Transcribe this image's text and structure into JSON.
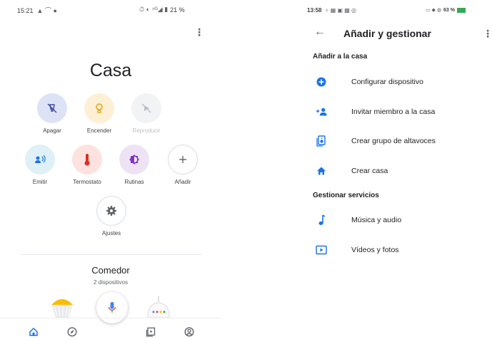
{
  "left": {
    "status": {
      "time": "15:21",
      "right_text": "21 %"
    },
    "title": "Casa",
    "quick_actions": [
      {
        "label": "Apagar",
        "icon": "lamp-off-icon",
        "bg": "#dde3f5",
        "fg": "#3c4ba8"
      },
      {
        "label": "Encender",
        "icon": "bulb-icon",
        "bg": "#fdf0d5",
        "fg": "#e8a317"
      },
      {
        "label": "Reproducir",
        "icon": "play-off-icon",
        "bg": "#f1f3f4",
        "fg": "#bdc1c6",
        "disabled": true
      },
      {
        "label": "Emitir",
        "icon": "cast-icon",
        "bg": "#dff0f7",
        "fg": "#1a73e8"
      },
      {
        "label": "Termostato",
        "icon": "thermometer-icon",
        "bg": "#fde2df",
        "fg": "#d93025"
      },
      {
        "label": "Rutinas",
        "icon": "routines-icon",
        "bg": "#eee3f5",
        "fg": "#8430ce"
      },
      {
        "label": "Añadir",
        "icon": "plus-icon",
        "bg": "#ffffff",
        "fg": "#5f6368"
      },
      {
        "label": "Ajustes",
        "icon": "gear-icon",
        "bg": "#ffffff",
        "fg": "#5f6368"
      }
    ],
    "room": {
      "name": "Comedor",
      "devices": "2 dispositivos"
    },
    "nav": [
      "home-icon",
      "explore-icon",
      "media-icon",
      "account-icon"
    ]
  },
  "right": {
    "status": {
      "time": "13:58",
      "battery": "63 %"
    },
    "title": "Añadir y gestionar",
    "section_add": "Añadir a la casa",
    "add_items": [
      {
        "label": "Configurar dispositivo",
        "icon": "add-circle-icon"
      },
      {
        "label": "Invitar miembro a la casa",
        "icon": "add-person-icon"
      },
      {
        "label": "Crear grupo de altavoces",
        "icon": "speaker-group-icon"
      },
      {
        "label": "Crear casa",
        "icon": "house-icon"
      }
    ],
    "section_manage": "Gestionar servicios",
    "manage_items": [
      {
        "label": "Música y audio",
        "icon": "music-note-icon"
      },
      {
        "label": "Vídeos y fotos",
        "icon": "video-photo-icon"
      }
    ],
    "accent": "#1a73e8"
  }
}
